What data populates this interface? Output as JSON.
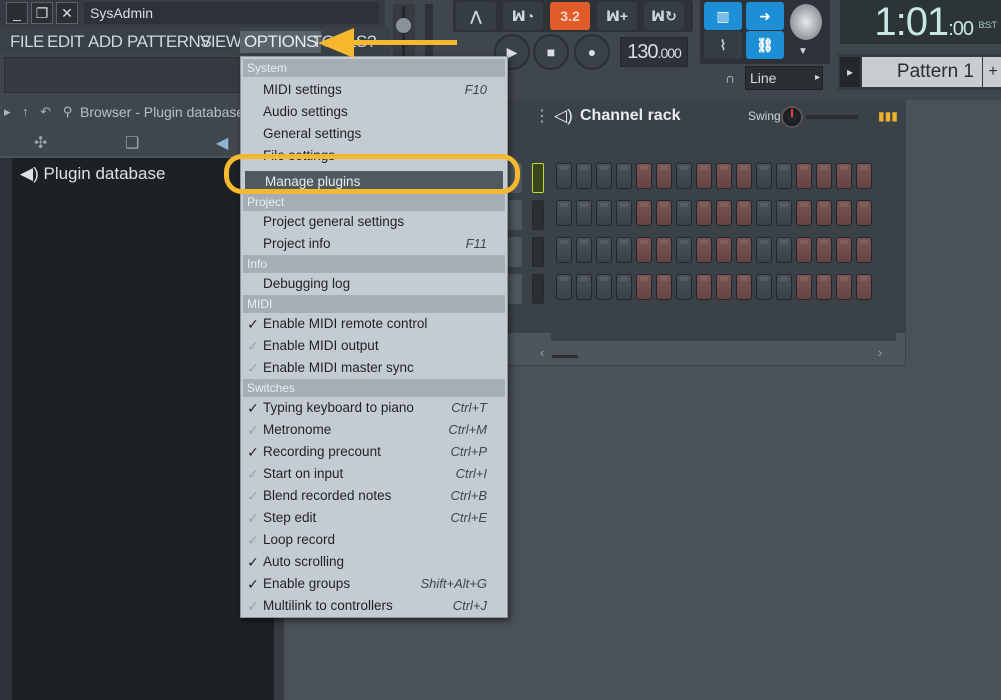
{
  "window": {
    "title": "SysAdmin",
    "minimize_glyph": "_",
    "restore_glyph": "❐",
    "close_glyph": "✕"
  },
  "menubar": {
    "items": [
      "FILE",
      "EDIT",
      "ADD",
      "PATTERNS",
      "VIEW",
      "OPTIONS",
      "TOOLS",
      "?"
    ],
    "active": "OPTIONS"
  },
  "transport": {
    "pattern_song_indicator": "3.2",
    "tempo_int": "130",
    "tempo_frac": ".000",
    "play_glyph": "▶",
    "stop_glyph": "■",
    "record_glyph": "●",
    "snap_mode": "Line",
    "snap_arrow_glyph": "▸",
    "clock_main": "1:01",
    "clock_sub": ":00",
    "clock_label": "B:S:T",
    "pattern_name": "Pattern 1",
    "pattern_prev_glyph": "▸",
    "pattern_add_glyph": "+"
  },
  "browser": {
    "title": "Browser - Plugin database",
    "nav_glyphs": "▸ ↑ ↶ ⚲",
    "item": "Plugin database",
    "item_icon_glyph": "◀)"
  },
  "channel_rack": {
    "title": "Channel rack",
    "title_icon_glyph": "◁)",
    "swing_label": "Swing",
    "scroll_glyphs": [
      "‹",
      "›"
    ],
    "rows": 4,
    "steps_per_row": 16
  },
  "options_menu": {
    "sections": [
      {
        "name": "System",
        "items": [
          {
            "label": "MIDI settings",
            "shortcut": "F10"
          },
          {
            "label": "Audio settings",
            "shortcut": ""
          },
          {
            "label": "General settings",
            "shortcut": ""
          },
          {
            "label": "File settings",
            "shortcut": ""
          },
          {
            "label": "Manage plugins",
            "shortcut": "",
            "highlighted": true
          }
        ]
      },
      {
        "name": "Project",
        "items": [
          {
            "label": "Project general settings",
            "shortcut": ""
          },
          {
            "label": "Project info",
            "shortcut": "F11"
          }
        ]
      },
      {
        "name": "Info",
        "items": [
          {
            "label": "Debugging log",
            "shortcut": ""
          }
        ]
      },
      {
        "name": "MIDI",
        "items": [
          {
            "label": "Enable MIDI remote control",
            "shortcut": "",
            "checked": true
          },
          {
            "label": "Enable MIDI output",
            "shortcut": "",
            "checked": false
          },
          {
            "label": "Enable MIDI master sync",
            "shortcut": "",
            "checked": false
          }
        ]
      },
      {
        "name": "Switches",
        "items": [
          {
            "label": "Typing keyboard to piano",
            "shortcut": "Ctrl+T",
            "checked": true
          },
          {
            "label": "Metronome",
            "shortcut": "Ctrl+M",
            "checked": false
          },
          {
            "label": "Recording precount",
            "shortcut": "Ctrl+P",
            "checked": true
          },
          {
            "label": "Start on input",
            "shortcut": "Ctrl+I",
            "checked": false
          },
          {
            "label": "Blend recorded notes",
            "shortcut": "Ctrl+B",
            "checked": false
          },
          {
            "label": "Step edit",
            "shortcut": "Ctrl+E",
            "checked": false
          },
          {
            "label": "Loop record",
            "shortcut": "",
            "checked": false
          },
          {
            "label": "Auto scrolling",
            "shortcut": "",
            "checked": true
          },
          {
            "label": "Enable groups",
            "shortcut": "Shift+Alt+G",
            "checked": true
          },
          {
            "label": "Multilink to controllers",
            "shortcut": "Ctrl+J",
            "checked": false
          }
        ]
      }
    ]
  },
  "annotation": {
    "highlight_target": "Manage plugins",
    "color": "#f5b82e"
  },
  "colors": {
    "accent_orange": "#e05a2a",
    "accent_blue": "#1d8fd6",
    "step_red": "#7d5655",
    "selected_channel": "#b8e030"
  }
}
